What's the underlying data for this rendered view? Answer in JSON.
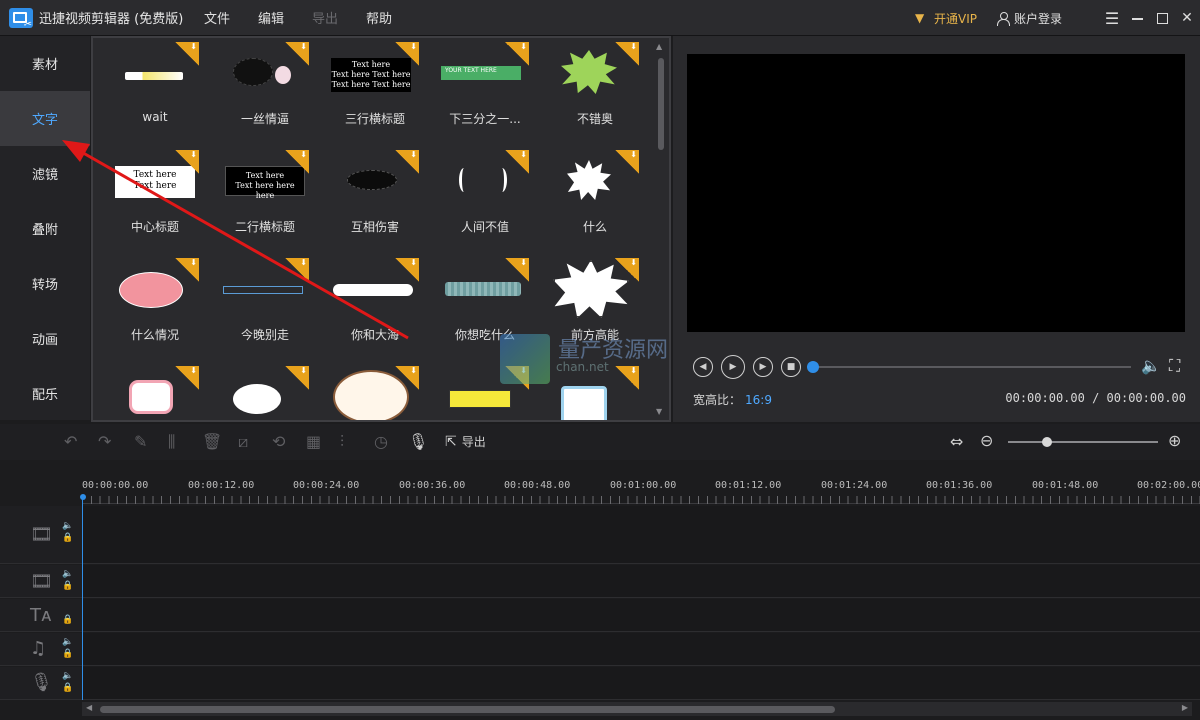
{
  "titlebar": {
    "app_title": "迅捷视频剪辑器 (免费版)",
    "menu": [
      "文件",
      "编辑",
      "导出",
      "帮助"
    ],
    "vip_label": "开通VIP",
    "account_label": "账户登录"
  },
  "sidebar": {
    "items": [
      "素材",
      "文字",
      "滤镜",
      "叠附",
      "转场",
      "动画",
      "配乐"
    ],
    "active": "文字"
  },
  "assets": {
    "tiles": [
      "wait",
      "一丝情逼",
      "三行横标题",
      "下三分之一...",
      "不错奥",
      "中心标题",
      "二行横标题",
      "互相伤害",
      "人间不值",
      "什么",
      "什么情况",
      "今晚别走",
      "你和大海",
      "你想吃什么",
      "前方高能",
      "",
      "",
      "",
      "",
      ""
    ],
    "thumb_text": {
      "three_line": [
        "Text here",
        "Text here Text here",
        "Text here Text here"
      ],
      "green_bar": "YOUR TEXT HERE",
      "center": [
        "Text here",
        "Text here"
      ],
      "two_line": [
        "Text here",
        "Text here here here"
      ]
    }
  },
  "preview": {
    "aspect_label": "宽高比：",
    "aspect_value": "16:9",
    "timecode": "00:00:00.00 / 00:00:00.00",
    "progress": 0
  },
  "timeline": {
    "export_label": "导出",
    "zoom_level": 0.26,
    "ruler": [
      "00:00:00.00",
      "00:00:12.00",
      "00:00:24.00",
      "00:00:36.00",
      "00:00:48.00",
      "00:01:00.00",
      "00:01:12.00",
      "00:01:24.00",
      "00:01:36.00",
      "00:01:48.00",
      "00:02:00.00"
    ]
  },
  "watermark": {
    "text": "量产资源网",
    "sub": "chan.net"
  },
  "colors": {
    "accent": "#2f8ee8",
    "active_text": "#4fa9ff",
    "vip": "#e8b44a",
    "badge": "#e8a21c",
    "arrow": "#e01818"
  }
}
